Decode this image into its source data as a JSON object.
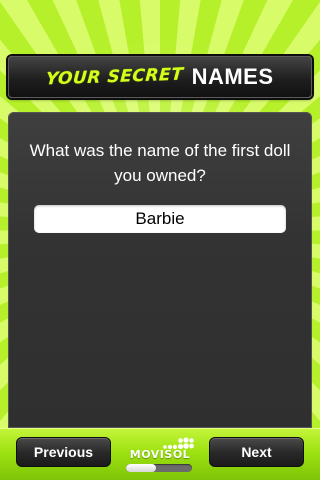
{
  "header": {
    "title_script": "YOUR SECRET",
    "title_block": "NAMES"
  },
  "question": {
    "text": "What was the name of the first doll you owned?"
  },
  "answer": {
    "value": "Barbie",
    "placeholder": ""
  },
  "footer": {
    "previous_label": "Previous",
    "next_label": "Next",
    "brand_label": "MOVISOL",
    "page_progress": 0.45
  },
  "colors": {
    "accent_green": "#b6f02a",
    "title_yellow": "#d4ff1a",
    "panel_dark": "#333333",
    "button_dark": "#2a2a2a"
  },
  "icons": {
    "brand_logo": "dots-logo-icon"
  }
}
